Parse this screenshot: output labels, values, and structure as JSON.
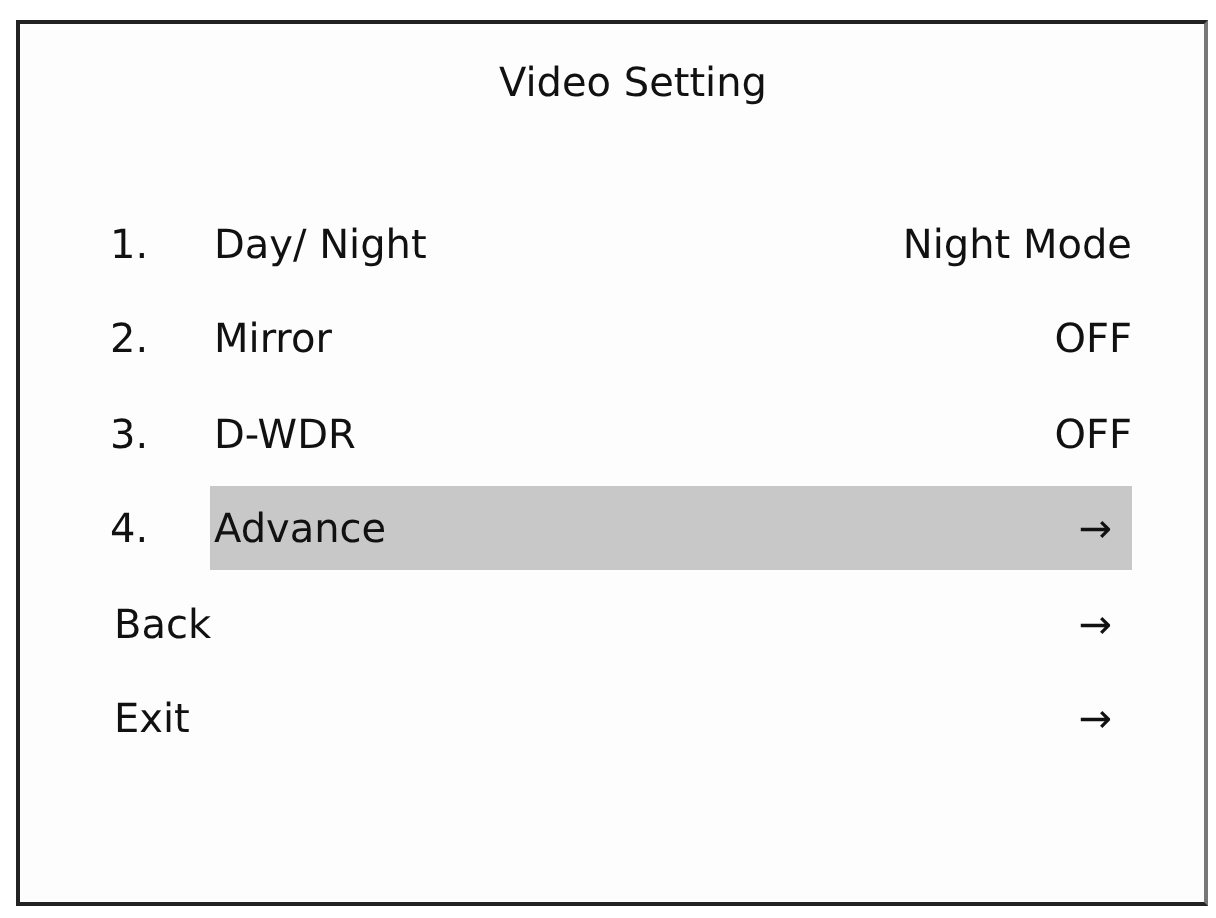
{
  "title": "Video Setting",
  "items": [
    {
      "number": "1.",
      "label": "Day/ Night",
      "value": "Night Mode",
      "kind": "text",
      "selected": false
    },
    {
      "number": "2.",
      "label": "Mirror",
      "value": "OFF",
      "kind": "text",
      "selected": false
    },
    {
      "number": "3.",
      "label": "D-WDR",
      "value": "OFF",
      "kind": "text",
      "selected": false
    },
    {
      "number": "4.",
      "label": "Advance",
      "value": "→",
      "kind": "arrow",
      "selected": true
    },
    {
      "label": "Back",
      "value": "→",
      "kind": "arrow",
      "selected": false
    },
    {
      "label": "Exit",
      "value": "→",
      "kind": "arrow",
      "selected": false
    }
  ]
}
